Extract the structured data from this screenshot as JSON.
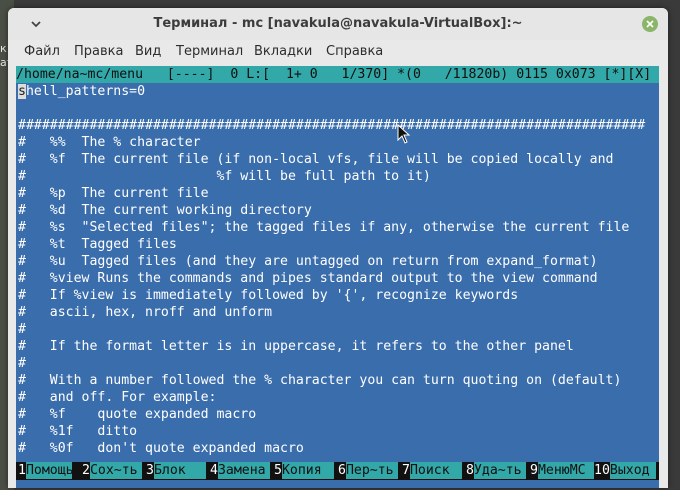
{
  "desktop": {
    "labels": [
      "к",
      "ат"
    ]
  },
  "window": {
    "title": "Терминал - mc [navakula@navakula-VirtualBox]:~",
    "menu": [
      "Файл",
      "Правка",
      "Вид",
      "Терминал",
      "Вкладки",
      "Справка"
    ]
  },
  "editor": {
    "status": "/home/na~mc/menu   [----]  0 L:[  1+ 0   1/370] *(0   /11820b) 0115 0x073 [*][X]",
    "cursor_char": "s",
    "lines": [
      "hell_patterns=0",
      "",
      "###############################################################################",
      "#   %%  The % character",
      "#   %f  The current file (if non-local vfs, file will be copied locally and",
      "#                        %f will be full path to it)",
      "#   %p  The current file",
      "#   %d  The current working directory",
      "#   %s  \"Selected files\"; the tagged files if any, otherwise the current file",
      "#   %t  Tagged files",
      "#   %u  Tagged files (and they are untagged on return from expand_format)",
      "#   %view Runs the commands and pipes standard output to the view command",
      "#   If %view is immediately followed by '{', recognize keywords",
      "#   ascii, hex, nroff and unform",
      "#",
      "#   If the format letter is in uppercase, it refers to the other panel",
      "#",
      "#   With a number followed the % character you can turn quoting on (default)",
      "#   and off. For example:",
      "#   %f    quote expanded macro",
      "#   %1f   ditto",
      "#   %0f   don't quote expanded macro"
    ]
  },
  "fkeys": [
    {
      "num": "1",
      "label": "Помощь"
    },
    {
      "num": "2",
      "label": "Сох~ть"
    },
    {
      "num": "3",
      "label": "Блок"
    },
    {
      "num": "4",
      "label": "Замена"
    },
    {
      "num": "5",
      "label": "Копия"
    },
    {
      "num": "6",
      "label": "Пер~ть"
    },
    {
      "num": "7",
      "label": "Поиск"
    },
    {
      "num": "8",
      "label": "Уда~ть"
    },
    {
      "num": "9",
      "label": "МенюМС"
    },
    {
      "num": "10",
      "label": "Выход"
    }
  ],
  "icons": {
    "window_menu": "chevron-down-icon",
    "close": "close-icon",
    "pointer": "mouse-pointer-icon"
  },
  "colors": {
    "terminal_bg": "#3a6dac",
    "status_bg": "#32a8a8",
    "close_button": "#8ab56a"
  }
}
